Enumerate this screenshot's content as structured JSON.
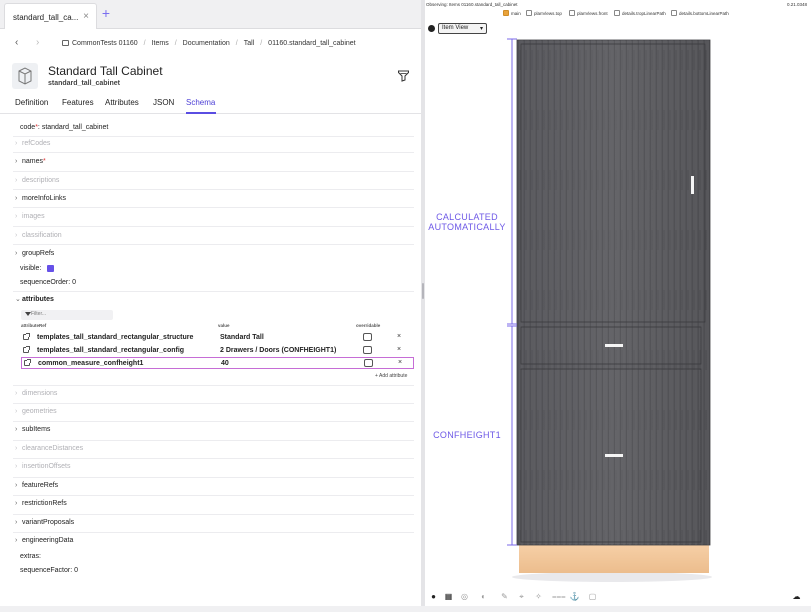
{
  "tab": {
    "label": "standard_tall_ca...",
    "close": "×",
    "add": "+"
  },
  "nav": {
    "back": "‹",
    "forward": "›"
  },
  "breadcrumb": [
    "CommonTests 01160",
    "Items",
    "Documentation",
    "Tall",
    "01160.standard_tall_cabinet"
  ],
  "header": {
    "title": "Standard Tall Cabinet",
    "subtitle": "standard_tall_cabinet"
  },
  "subtabs": [
    "Definition",
    "Features",
    "Attributes",
    "JSON",
    "Schema"
  ],
  "active_subtab": "Schema",
  "schema": {
    "code_label": "code",
    "code_value": "standard_tall_cabinet",
    "refCodes": "refCodes",
    "names": "names",
    "descriptions": "descriptions",
    "moreInfoLinks": "moreInfoLinks",
    "images": "images",
    "classification": "classification",
    "groupRefs": "groupRefs",
    "visible_label": "visible:",
    "sequenceOrder_label": "sequenceOrder:",
    "sequenceOrder_value": "0",
    "attributes": "attributes",
    "dimensions": "dimensions",
    "geometries": "geometries",
    "subItems": "subItems",
    "clearanceDistances": "clearanceDistances",
    "insertionOffsets": "insertionOffsets",
    "featureRefs": "featureRefs",
    "restrictionRefs": "restrictionRefs",
    "variantProposals": "variantProposals",
    "engineeringData": "engineeringData",
    "extras_label": "extras:",
    "sequenceFactor_label": "sequenceFactor:",
    "sequenceFactor_value": "0"
  },
  "attributes_table": {
    "filter_placeholder": "Filter...",
    "headers": [
      "attributeRef",
      "value",
      "overridable"
    ],
    "rows": [
      {
        "ref": "templates_tall_standard_rectangular_structure",
        "value": "Standard Tall"
      },
      {
        "ref": "templates_tall_standard_rectangular_config",
        "value": "2 Drawers / Doors (CONFHEIGHT1)"
      },
      {
        "ref": "common_measure_confheight1",
        "value": "40"
      }
    ],
    "remove": "×",
    "add_label": "+ Add attribute"
  },
  "viewer": {
    "observing": "Observing: Items 01160.standard_tall_cabinet",
    "version": "0.21.0348",
    "options": [
      {
        "label": "main",
        "checked": true
      },
      {
        "label": "planViews.top",
        "checked": false
      },
      {
        "label": "planViews.front",
        "checked": false
      },
      {
        "label": "details.tropLinearPath",
        "checked": false
      },
      {
        "label": "details.bottomLinearPath",
        "checked": false
      }
    ],
    "view_select": "Item View",
    "annotation_upper": [
      "CALCULATED",
      "AUTOMATICALLY"
    ],
    "annotation_lower": "CONFHEIGHT1",
    "colors": {
      "cabinet": "#5a5a5d",
      "plinth": "#f2c9a0",
      "annotation": "#6d58e6",
      "accent": "#5a4de2"
    },
    "tool_icons": [
      "pointer-icon",
      "grid-icon",
      "circle-icon",
      "globe-icon",
      "pencil-icon",
      "crosshair-icon",
      "target-icon",
      "ruler-icon",
      "anchor-icon",
      "layers-icon"
    ],
    "tool_glyphs": [
      "●",
      "▦",
      "◎",
      "◐",
      "✎",
      "⌖",
      "✧",
      "⩶",
      "⚓",
      "▢"
    ],
    "cloud_glyph": "☁"
  }
}
